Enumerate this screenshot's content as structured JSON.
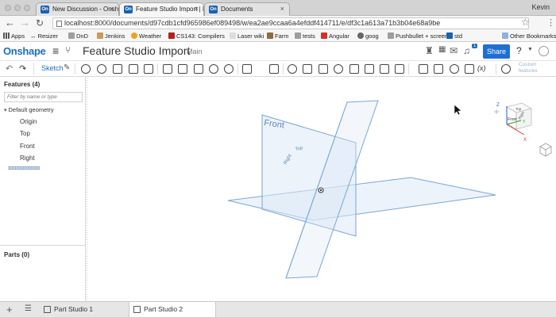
{
  "browser": {
    "tabs": [
      {
        "label": "New Discussion - Onshape",
        "icon": "onshape-favicon"
      },
      {
        "label": "Feature Studio Import | Pa",
        "icon": "onshape-favicon"
      },
      {
        "label": "Documents",
        "icon": "onshape-favicon"
      }
    ],
    "user": "Kevin",
    "url": "localhost:8000/documents/d97cdb1cfd965986ef089498/w/ea2ae9ccaa6a4efddf414711/e/df3c1a613a71b3b04e68a9be",
    "bookmarks": [
      "Apps",
      "↔ Resizer",
      "DnD",
      "Jenkins",
      "Weather",
      "CS143: Compilers",
      "Laser wiki",
      "Farm",
      "tests",
      "Angular",
      "goog",
      "Pushbullet + screen",
      "std",
      "Other Bookmarks"
    ]
  },
  "header": {
    "logo": "Onshape",
    "title": "Feature Studio Import",
    "branch": "Main",
    "notifications": "1",
    "share_label": "Share"
  },
  "toolbar": {
    "sketch_label": "Sketch",
    "fx_label": "(x)",
    "custom_label": "Custom features"
  },
  "features": {
    "title": "Features (4)",
    "filter_placeholder": "Filter by name or type",
    "default_geometry": "Default geometry",
    "items": [
      "Origin",
      "Top",
      "Front",
      "Right"
    ]
  },
  "parts": {
    "title": "Parts (0)"
  },
  "viewport": {
    "plane_labels": {
      "front": "Front",
      "top": "Top",
      "right": "Right"
    },
    "viewcube": {
      "top": "Top",
      "front": "Front",
      "right": "Right",
      "axes": [
        "X",
        "Y",
        "Z"
      ]
    }
  },
  "bottom_tabs": [
    {
      "label": "Part Studio 1",
      "active": false
    },
    {
      "label": "Part Studio 2",
      "active": true
    }
  ],
  "colors": {
    "brand": "#1b6fc4",
    "share": "#1f6fd1",
    "plane": "#7aa6d6"
  }
}
